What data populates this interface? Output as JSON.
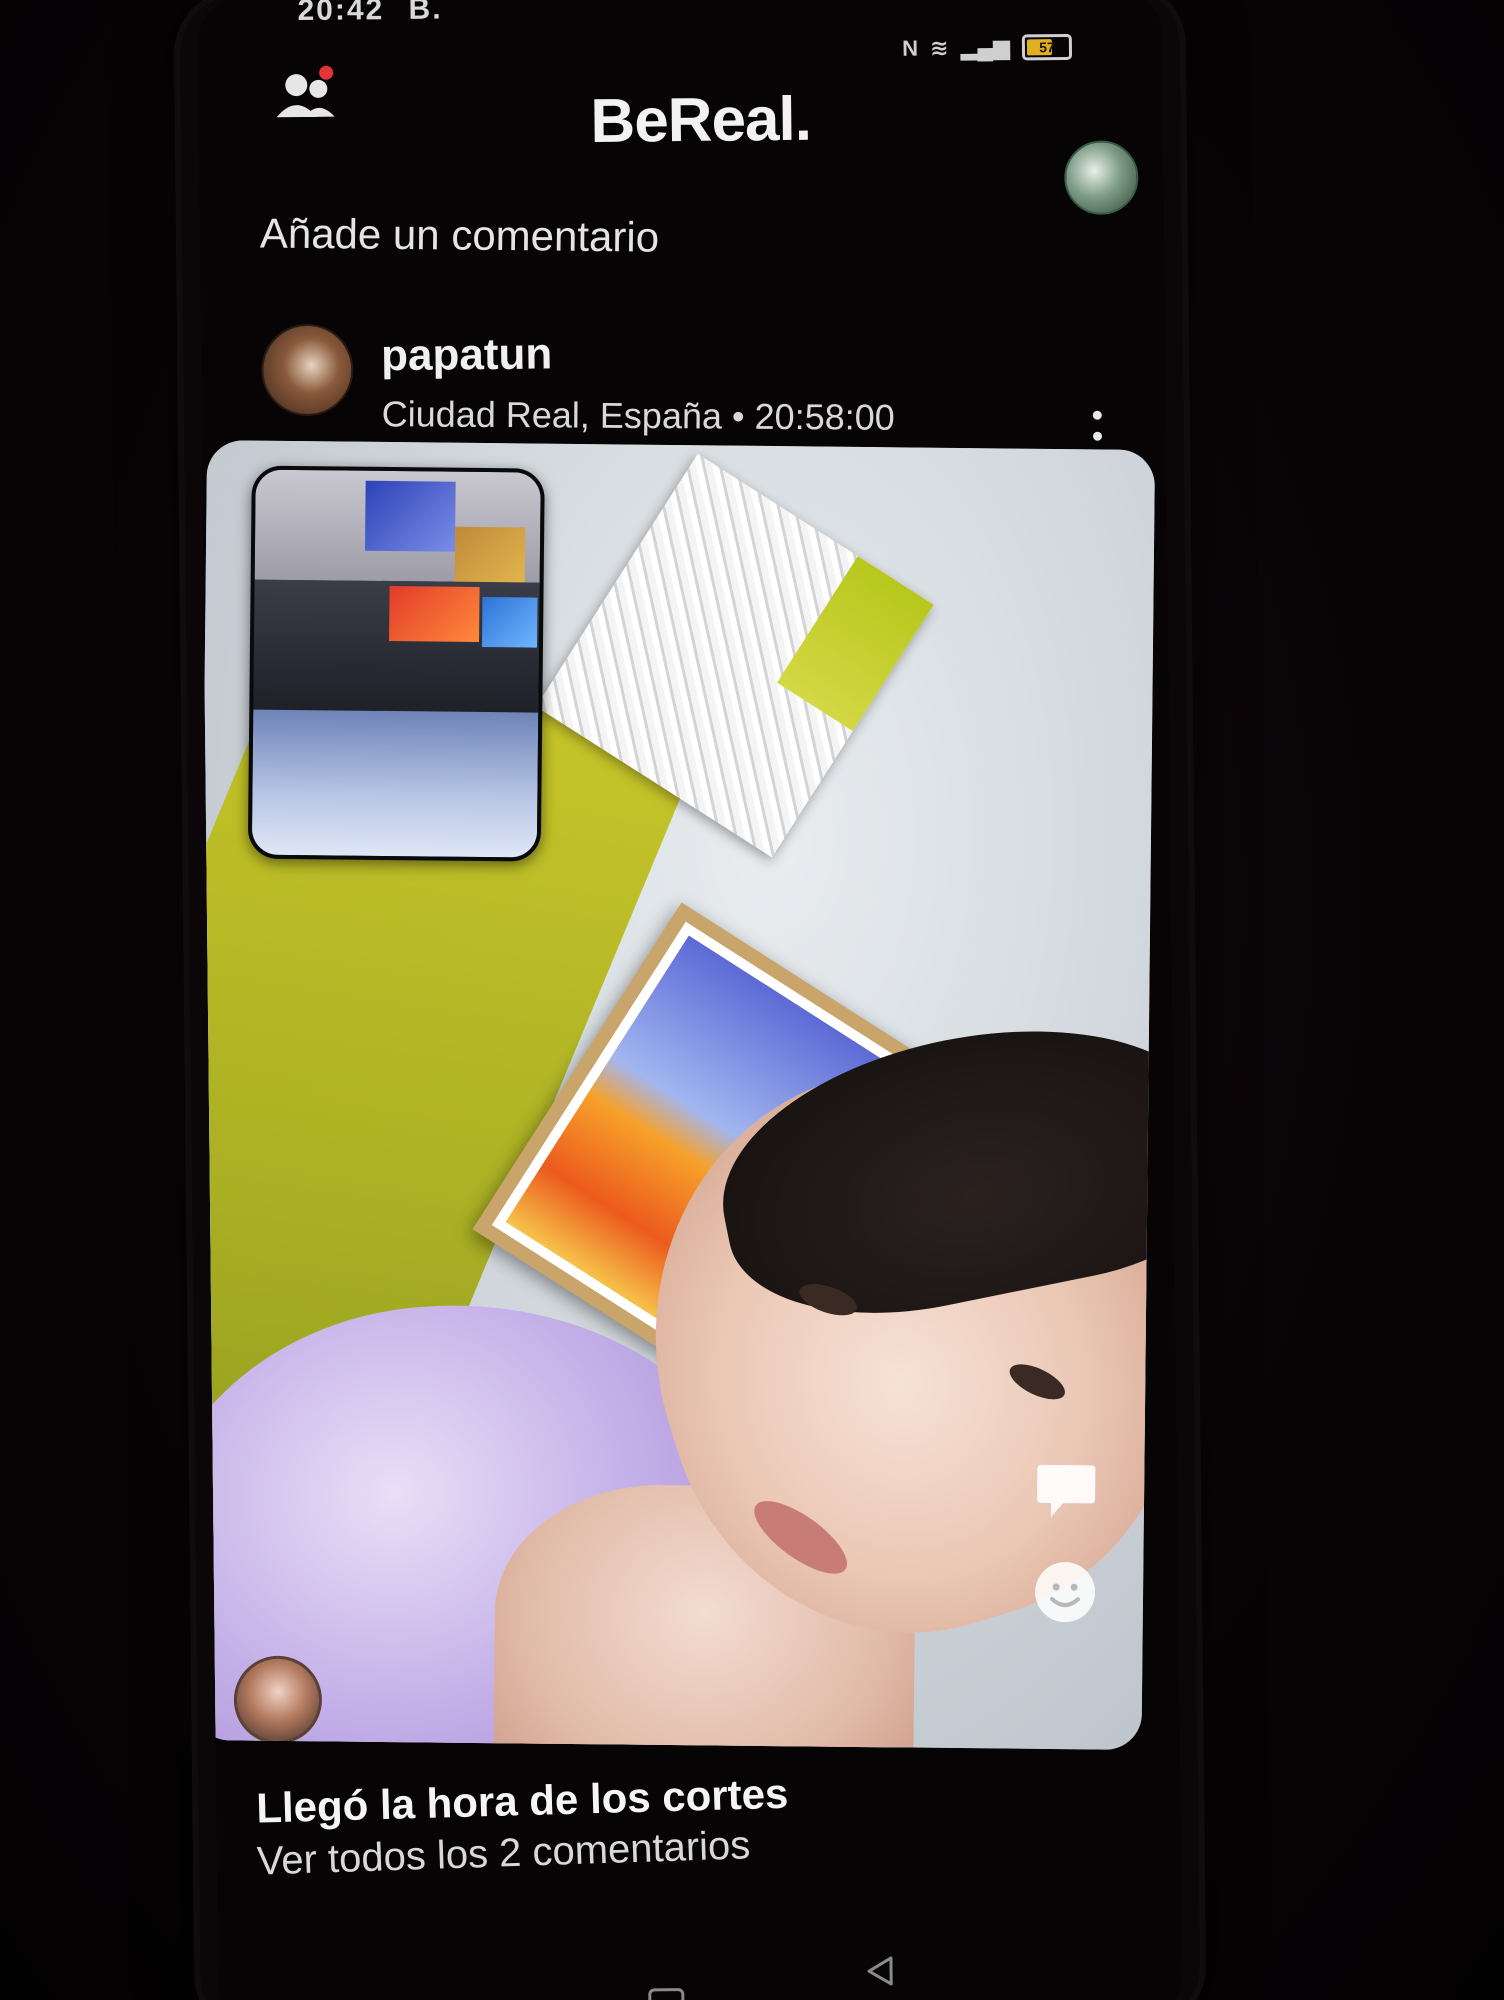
{
  "status_bar": {
    "time": "20:42",
    "notification_icons": "B.",
    "battery_level": "57",
    "battery_fraction": 0.57,
    "battery_color": "#e0b020"
  },
  "header": {
    "app_title": "BeReal.",
    "friends_icon": "friends-icon",
    "profile_icon": "profile-avatar"
  },
  "comment_prompt": "Añade un comentario",
  "post": {
    "username": "papatun",
    "location": "Ciudad Real, España",
    "separator": "•",
    "time": "20:58:00",
    "more_icon": "more-vertical-icon",
    "caption": "Llegó la hora de los cortes",
    "view_comments": "Ver todos los 2 comentarios"
  },
  "actions": {
    "comment_icon": "comment-bubble-icon",
    "react_icon": "smiley-icon"
  },
  "nav": {
    "recent_icon": "recent-apps-icon",
    "home_icon": "home-icon",
    "back_icon": "back-icon"
  },
  "colors": {
    "background": "#060405",
    "text": "#f4f4f4",
    "notification_dot": "#e5333a"
  }
}
